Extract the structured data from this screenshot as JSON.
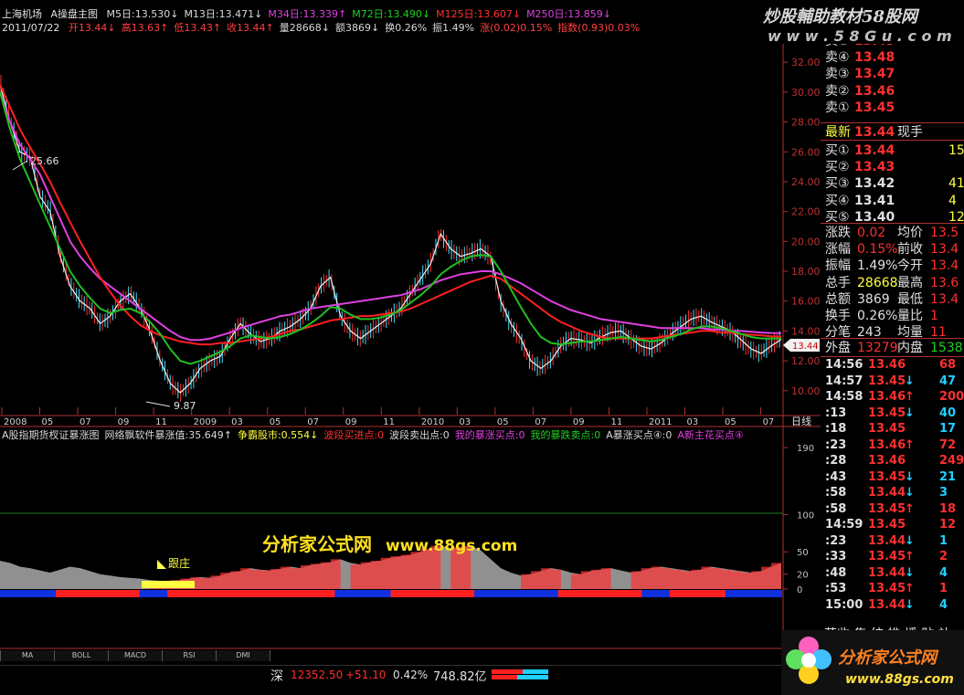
{
  "header": {
    "line1": {
      "stock_name": "上海机场",
      "indicator_name": "A操盘主图",
      "mas": [
        {
          "label": "M5日:13.530↓",
          "color": "#d8d8d8"
        },
        {
          "label": "M13日:13.471↓",
          "color": "#d8d8d8"
        },
        {
          "label": "M34日:13.339↑",
          "color": "#e040e0"
        },
        {
          "label": "M72日:13.490↓",
          "color": "#20d020"
        },
        {
          "label": "M125日:13.607↓",
          "color": "#ff3030"
        },
        {
          "label": "M250日:13.859↓",
          "color": "#e040e0"
        }
      ]
    },
    "line2": {
      "date": "2011/07/22",
      "items": [
        {
          "label": "开13.44↓",
          "color": "#ff4040"
        },
        {
          "label": "高13.63↑",
          "color": "#ff4040"
        },
        {
          "label": "低13.43↑",
          "color": "#ff4040"
        },
        {
          "label": "收13.44↑",
          "color": "#ff4040"
        },
        {
          "label": "量28668↓",
          "color": "#d8d8d8"
        },
        {
          "label": "额3869↓",
          "color": "#d8d8d8"
        },
        {
          "label": "换0.26%",
          "color": "#d8d8d8"
        },
        {
          "label": "振1.49%",
          "color": "#d8d8d8"
        },
        {
          "label": "涨(0.02)0.15%",
          "color": "#ff4040"
        },
        {
          "label": "指数(0.93)0.03%",
          "color": "#ff4040"
        }
      ]
    }
  },
  "watermark_top": {
    "line1": "炒股輔助教材58股网",
    "line2": "w w w . 5 8 G u . c o m"
  },
  "chart_data": [
    {
      "type": "line",
      "title": "A操盘主图",
      "ylim": [
        9.5,
        32.5
      ],
      "y_ticks": [
        "32.00",
        "30.00",
        "28.00",
        "26.00",
        "24.00",
        "22.00",
        "20.00",
        "18.00",
        "16.00",
        "14.00",
        "12.00",
        "10.00"
      ],
      "x_ticks": [
        "2008",
        "05",
        "07",
        "09",
        "11",
        "2009",
        "03",
        "05",
        "07",
        "09",
        "11",
        "2010",
        "03",
        "05",
        "07",
        "09",
        "11",
        "2011",
        "03",
        "05",
        "07"
      ],
      "period_label": "日线",
      "price_tag": "13.44",
      "annotations": [
        "25.66",
        "9.87"
      ],
      "series": [
        {
          "color": "#f0f0f0",
          "values": [
            30.5,
            28,
            26,
            25.66,
            23,
            22,
            19,
            17,
            16,
            15.5,
            14.5,
            15,
            16,
            16.5,
            15.5,
            14,
            12,
            10.5,
            9.87,
            10.5,
            11.5,
            12,
            12.3,
            13.5,
            14.5,
            13.8,
            13.3,
            13.5,
            14,
            14.3,
            14.8,
            15.5,
            17,
            17.6,
            15,
            14,
            13.5,
            14,
            14.5,
            15,
            15.5,
            16.5,
            17.5,
            18.5,
            20.5,
            19.5,
            19,
            19.2,
            19.5,
            19,
            16,
            14.5,
            13.5,
            12,
            11.5,
            12,
            13,
            13.5,
            13.4,
            13.2,
            13.6,
            13.9,
            14,
            13.5,
            13,
            12.8,
            13.2,
            13.8,
            14.3,
            14.8,
            15,
            14.6,
            14.3,
            14,
            13.4,
            12.8,
            12.5,
            13,
            13.44
          ]
        },
        {
          "color": "#e040e0",
          "values": [
            30,
            28,
            26.5,
            25.5,
            24.5,
            23,
            21.5,
            20,
            19,
            18.2,
            17.5,
            17,
            16.5,
            16,
            15.5,
            15,
            14.5,
            14,
            13.6,
            13.4,
            13.4,
            13.5,
            13.7,
            13.9,
            14.2,
            14.4,
            14.6,
            14.8,
            15,
            15.1,
            15.3,
            15.5,
            15.6,
            15.7,
            15.8,
            15.9,
            16,
            16.1,
            16.2,
            16.3,
            16.4,
            16.6,
            16.8,
            17.1,
            17.4,
            17.6,
            17.8,
            17.9,
            18,
            18,
            17.8,
            17.5,
            17.2,
            16.8,
            16.4,
            16,
            15.7,
            15.4,
            15.2,
            15,
            14.8,
            14.7,
            14.6,
            14.5,
            14.4,
            14.3,
            14.2,
            14.2,
            14.2,
            14.2,
            14.2,
            14.1,
            14.1,
            14,
            14,
            13.95,
            13.9,
            13.87,
            13.86
          ]
        },
        {
          "color": "#ff2020",
          "values": [
            30.5,
            29,
            27.5,
            26.3,
            25.2,
            24,
            22.6,
            21.3,
            20,
            18.8,
            17.6,
            16.6,
            15.7,
            15,
            14.4,
            14,
            13.7,
            13.5,
            13.3,
            13.2,
            13.1,
            13.1,
            13.2,
            13.2,
            13.3,
            13.4,
            13.5,
            13.6,
            13.8,
            14,
            14.1,
            14.3,
            14.5,
            14.7,
            14.8,
            14.9,
            15,
            15,
            15.1,
            15.2,
            15.3,
            15.5,
            15.8,
            16.1,
            16.4,
            16.7,
            17,
            17.3,
            17.5,
            17.7,
            17.5,
            17,
            16.5,
            16,
            15.5,
            15,
            14.6,
            14.3,
            14,
            13.8,
            13.6,
            13.5,
            13.5,
            13.5,
            13.5,
            13.5,
            13.6,
            13.7,
            13.8,
            13.9,
            14,
            14,
            13.9,
            13.9,
            13.8,
            13.75,
            13.7,
            13.65,
            13.61
          ]
        },
        {
          "color": "#20c020",
          "values": [
            30,
            27.5,
            25.5,
            24,
            22.5,
            21,
            19.5,
            18,
            17,
            16.2,
            15.5,
            15.2,
            15.4,
            15.5,
            15.2,
            14.6,
            13.8,
            12.8,
            12,
            11.8,
            12,
            12.3,
            12.6,
            13,
            13.5,
            13.7,
            13.6,
            13.5,
            13.6,
            13.8,
            14.1,
            14.5,
            15,
            15.6,
            15.5,
            15.1,
            14.8,
            14.8,
            14.9,
            15.1,
            15.4,
            15.9,
            16.4,
            17,
            17.8,
            18.3,
            18.7,
            19,
            19.1,
            19,
            18,
            16.8,
            15.6,
            14.5,
            13.6,
            13.2,
            13.1,
            13.2,
            13.3,
            13.3,
            13.4,
            13.5,
            13.6,
            13.5,
            13.4,
            13.3,
            13.4,
            13.6,
            13.8,
            14.1,
            14.3,
            14.3,
            14.2,
            14,
            13.8,
            13.6,
            13.5,
            13.5,
            13.49
          ]
        }
      ]
    },
    {
      "type": "area",
      "title": "A股指期货杈证暴涨图",
      "ylim": [
        -70,
        200
      ],
      "y_ticks": [
        "190",
        "100",
        "50",
        "20",
        "0",
        "-70"
      ],
      "annotation": "跟庄",
      "legend": [
        {
          "label": "A股指期货杈证暴涨图",
          "color": "#d8d8d8"
        },
        {
          "label": "网络飘软件暴涨值:35.649↑",
          "color": "#d8d8d8"
        },
        {
          "label": "争霸股市:0.554↓",
          "color": "#ffff40"
        },
        {
          "label": "波段买进点:0",
          "color": "#ff3030"
        },
        {
          "label": "波段卖出点:0",
          "color": "#d8d8d8"
        },
        {
          "label": "我的暴涨买点:0",
          "color": "#e040e0"
        },
        {
          "label": "我的暴跌卖点:0",
          "color": "#20d020"
        },
        {
          "label": "A暴涨买点④:0",
          "color": "#d8d8d8"
        },
        {
          "label": "A新主花买点④",
          "color": "#e040e0"
        }
      ],
      "values": [
        38,
        35,
        30,
        28,
        25,
        22,
        26,
        30,
        28,
        24,
        20,
        18,
        16,
        15,
        14,
        12,
        11,
        10,
        12,
        14,
        16,
        15,
        18,
        22,
        24,
        28,
        26,
        25,
        27,
        30,
        28,
        32,
        34,
        36,
        40,
        35,
        33,
        36,
        38,
        42,
        44,
        46,
        50,
        54,
        58,
        55,
        56,
        58,
        52,
        40,
        28,
        22,
        18,
        20,
        24,
        28,
        26,
        22,
        20,
        24,
        26,
        28,
        25,
        22,
        24,
        28,
        30,
        28,
        26,
        24,
        26,
        30,
        28,
        26,
        24,
        22,
        24,
        30,
        35
      ]
    }
  ],
  "watermark_mid": {
    "text": "分析家公式网",
    "url": "www.88gs.com"
  },
  "quote_panel": {
    "sell": [
      {
        "label": "卖⑤",
        "price": "13.49"
      },
      {
        "label": "卖④",
        "price": "13.48"
      },
      {
        "label": "卖③",
        "price": "13.47"
      },
      {
        "label": "卖②",
        "price": "13.46"
      },
      {
        "label": "卖①",
        "price": "13.45"
      }
    ],
    "latest": {
      "label": "最新",
      "price": "13.44",
      "extra": "现手"
    },
    "buy": [
      {
        "label": "买①",
        "price": "13.44",
        "vol": "15"
      },
      {
        "label": "买②",
        "price": "13.43",
        "vol": ""
      },
      {
        "label": "买③",
        "price": "13.42",
        "vol": "41"
      },
      {
        "label": "买④",
        "price": "13.41",
        "vol": "4"
      },
      {
        "label": "买⑤",
        "price": "13.40",
        "vol": "12"
      }
    ],
    "stats": [
      {
        "l1": "涨跌",
        "v1": "0.02",
        "c1": "#ff3030",
        "l2": "均价",
        "v2": "13.5"
      },
      {
        "l1": "涨幅",
        "v1": "0.15%",
        "c1": "#ff3030",
        "l2": "前收",
        "v2": "13.4"
      },
      {
        "l1": "振幅",
        "v1": "1.49%",
        "c1": "#e0e0e0",
        "l2": "今开",
        "v2": "13.4"
      },
      {
        "l1": "总手",
        "v1": "28668",
        "c1": "#ffff40",
        "l2": "最高",
        "v2": "13.6"
      },
      {
        "l1": "总额",
        "v1": "3869",
        "c1": "#e0e0e0",
        "l2": "最低",
        "v2": "13.4"
      },
      {
        "l1": "换手",
        "v1": "0.26%",
        "c1": "#e0e0e0",
        "l2": "量比",
        "v2": "1"
      },
      {
        "l1": "分笔",
        "v1": "243",
        "c1": "#e0e0e0",
        "l2": "均量",
        "v2": "11"
      }
    ],
    "outer": {
      "label": "外盘",
      "value": "13279",
      "label2": "内盘",
      "value2": "1538"
    },
    "ticks": [
      {
        "time": "14:56",
        "price": "13.46",
        "arrow": "",
        "vol": "68",
        "pc": "#ff3030",
        "vc": "#ff3030"
      },
      {
        "time": "14:57",
        "price": "13.45",
        "arrow": "↓",
        "vol": "47",
        "pc": "#ff3030",
        "vc": "#20d0ff"
      },
      {
        "time": "14:58",
        "price": "13.46",
        "arrow": "↑",
        "vol": "200",
        "pc": "#ff3030",
        "vc": "#ff3030"
      },
      {
        "time": ":13",
        "price": "13.45",
        "arrow": "↓",
        "vol": "40",
        "pc": "#ff3030",
        "vc": "#20d0ff"
      },
      {
        "time": ":18",
        "price": "13.45",
        "arrow": "",
        "vol": "17",
        "pc": "#ff3030",
        "vc": "#20d0ff"
      },
      {
        "time": ":23",
        "price": "13.46",
        "arrow": "↑",
        "vol": "72",
        "pc": "#ff3030",
        "vc": "#ff3030"
      },
      {
        "time": ":28",
        "price": "13.46",
        "arrow": "",
        "vol": "249",
        "pc": "#ff3030",
        "vc": "#ff3030"
      },
      {
        "time": ":43",
        "price": "13.45",
        "arrow": "↓",
        "vol": "21",
        "pc": "#ff3030",
        "vc": "#20d0ff"
      },
      {
        "time": ":58",
        "price": "13.44",
        "arrow": "↓",
        "vol": "3",
        "pc": "#ff3030",
        "vc": "#20d0ff"
      },
      {
        "time": ":58",
        "price": "13.45",
        "arrow": "↑",
        "vol": "18",
        "pc": "#ff3030",
        "vc": "#ff3030"
      },
      {
        "time": "14:59",
        "price": "13.45",
        "arrow": "",
        "vol": "12",
        "pc": "#ff3030",
        "vc": "#ff3030"
      },
      {
        "time": ":23",
        "price": "13.44",
        "arrow": "↓",
        "vol": "1",
        "pc": "#ff3030",
        "vc": "#20d0ff"
      },
      {
        "time": ":33",
        "price": "13.45",
        "arrow": "↑",
        "vol": "2",
        "pc": "#ff3030",
        "vc": "#ff3030"
      },
      {
        "time": ":48",
        "price": "13.44",
        "arrow": "↓",
        "vol": "4",
        "pc": "#ff3030",
        "vc": "#20d0ff"
      },
      {
        "time": ":53",
        "price": "13.45",
        "arrow": "↑",
        "vol": "1",
        "pc": "#ff3030",
        "vc": "#ff3030"
      },
      {
        "time": "15:00",
        "price": "13.44",
        "arrow": "↓",
        "vol": "4",
        "pc": "#ff3030",
        "vc": "#20d0ff"
      }
    ],
    "bottom": "营收 集 统 推 播 贴 补"
  },
  "tabs": [
    "MA",
    "BOLL",
    "MACD",
    "RSI",
    "DMI"
  ],
  "status": {
    "market": "深",
    "index": "12352.50",
    "change": "+51.10",
    "pct": "0.42%",
    "amount": "748.82亿"
  },
  "logo": {
    "brand": "分析家公式网",
    "url": "www.88gs.com"
  }
}
